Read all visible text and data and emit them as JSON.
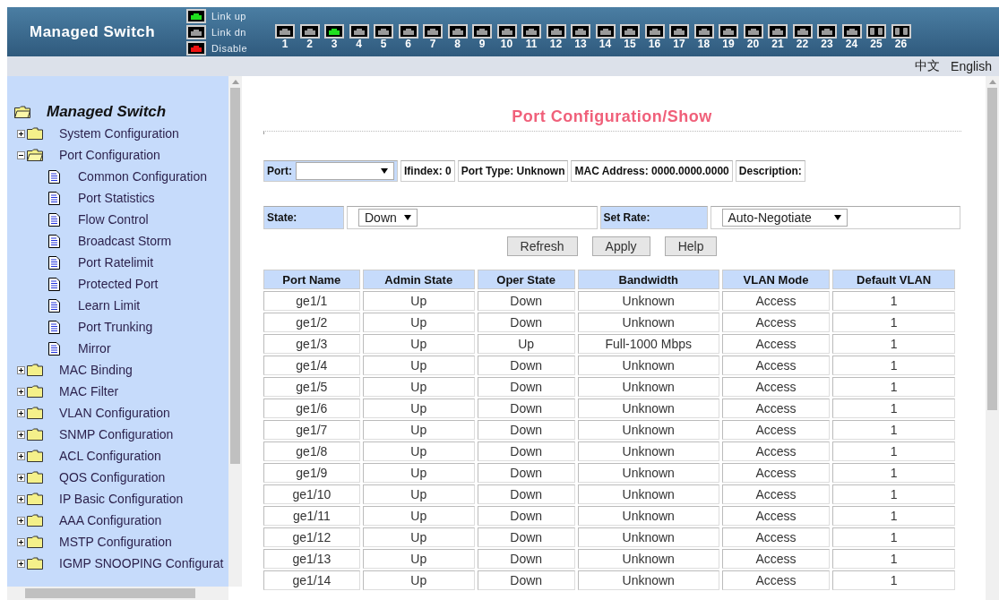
{
  "header": {
    "title": "Managed Switch",
    "legend": [
      {
        "label": "Link up",
        "color": "#1fe01f"
      },
      {
        "label": "Link dn",
        "color": "#9a9a9a"
      },
      {
        "label": "Disable",
        "color": "#ee1111"
      }
    ],
    "ports": [
      {
        "label": "1",
        "kind": "copper",
        "color": "#9a9a9a"
      },
      {
        "label": "2",
        "kind": "copper",
        "color": "#9a9a9a"
      },
      {
        "label": "3",
        "kind": "copper",
        "color": "#1fe01f"
      },
      {
        "label": "4",
        "kind": "copper",
        "color": "#9a9a9a"
      },
      {
        "label": "5",
        "kind": "copper",
        "color": "#9a9a9a"
      },
      {
        "label": "6",
        "kind": "copper",
        "color": "#9a9a9a"
      },
      {
        "label": "7",
        "kind": "copper",
        "color": "#9a9a9a"
      },
      {
        "label": "8",
        "kind": "copper",
        "color": "#9a9a9a"
      },
      {
        "label": "9",
        "kind": "copper",
        "color": "#9a9a9a"
      },
      {
        "label": "10",
        "kind": "copper",
        "color": "#9a9a9a"
      },
      {
        "label": "11",
        "kind": "copper",
        "color": "#9a9a9a"
      },
      {
        "label": "12",
        "kind": "copper",
        "color": "#9a9a9a"
      },
      {
        "label": "13",
        "kind": "copper",
        "color": "#9a9a9a"
      },
      {
        "label": "14",
        "kind": "copper",
        "color": "#9a9a9a"
      },
      {
        "label": "15",
        "kind": "copper",
        "color": "#9a9a9a"
      },
      {
        "label": "16",
        "kind": "copper",
        "color": "#9a9a9a"
      },
      {
        "label": "17",
        "kind": "copper",
        "color": "#9a9a9a"
      },
      {
        "label": "18",
        "kind": "copper",
        "color": "#9a9a9a"
      },
      {
        "label": "19",
        "kind": "copper",
        "color": "#9a9a9a"
      },
      {
        "label": "20",
        "kind": "copper",
        "color": "#9a9a9a"
      },
      {
        "label": "21",
        "kind": "copper",
        "color": "#9a9a9a"
      },
      {
        "label": "22",
        "kind": "copper",
        "color": "#9a9a9a"
      },
      {
        "label": "23",
        "kind": "copper",
        "color": "#9a9a9a"
      },
      {
        "label": "24",
        "kind": "copper",
        "color": "#9a9a9a"
      },
      {
        "label": "25",
        "kind": "fiber",
        "color": "#9a9a9a"
      },
      {
        "label": "26",
        "kind": "fiber",
        "color": "#9a9a9a"
      }
    ]
  },
  "languages": [
    "中文",
    "English"
  ],
  "sidebar": {
    "root": "Managed Switch",
    "items": [
      {
        "label": "System Configuration",
        "expanded": false
      },
      {
        "label": "Port Configuration",
        "expanded": true,
        "children": [
          {
            "label": "Common Configuration"
          },
          {
            "label": "Port Statistics"
          },
          {
            "label": "Flow Control"
          },
          {
            "label": "Broadcast Storm"
          },
          {
            "label": "Port Ratelimit"
          },
          {
            "label": "Protected Port"
          },
          {
            "label": "Learn Limit"
          },
          {
            "label": "Port Trunking"
          },
          {
            "label": "Mirror"
          }
        ]
      },
      {
        "label": "MAC Binding",
        "expanded": false
      },
      {
        "label": "MAC Filter",
        "expanded": false
      },
      {
        "label": "VLAN Configuration",
        "expanded": false
      },
      {
        "label": "SNMP Configuration",
        "expanded": false
      },
      {
        "label": "ACL Configuration",
        "expanded": false
      },
      {
        "label": "QOS Configuration",
        "expanded": false
      },
      {
        "label": "IP Basic Configuration",
        "expanded": false
      },
      {
        "label": "AAA Configuration",
        "expanded": false
      },
      {
        "label": "MSTP Configuration",
        "expanded": false
      },
      {
        "label": "IGMP SNOOPING Configurat",
        "expanded": false
      }
    ]
  },
  "content": {
    "title": "Port Configuration/Show",
    "info": {
      "port_label": "Port:",
      "ifindex": "Ifindex: 0",
      "port_type": "Port Type: Unknown",
      "mac": "MAC Address: 0000.0000.0000",
      "description": "Description:"
    },
    "state_label": "State:",
    "state_value": "Down",
    "rate_label": "Set Rate:",
    "rate_value": "Auto-Negotiate",
    "buttons": [
      "Refresh",
      "Apply",
      "Help"
    ],
    "table": {
      "columns": [
        "Port Name",
        "Admin State",
        "Oper State",
        "Bandwidth",
        "VLAN Mode",
        "Default VLAN"
      ],
      "rows": [
        [
          "ge1/1",
          "Up",
          "Down",
          "Unknown",
          "Access",
          "1"
        ],
        [
          "ge1/2",
          "Up",
          "Down",
          "Unknown",
          "Access",
          "1"
        ],
        [
          "ge1/3",
          "Up",
          "Up",
          "Full-1000 Mbps",
          "Access",
          "1"
        ],
        [
          "ge1/4",
          "Up",
          "Down",
          "Unknown",
          "Access",
          "1"
        ],
        [
          "ge1/5",
          "Up",
          "Down",
          "Unknown",
          "Access",
          "1"
        ],
        [
          "ge1/6",
          "Up",
          "Down",
          "Unknown",
          "Access",
          "1"
        ],
        [
          "ge1/7",
          "Up",
          "Down",
          "Unknown",
          "Access",
          "1"
        ],
        [
          "ge1/8",
          "Up",
          "Down",
          "Unknown",
          "Access",
          "1"
        ],
        [
          "ge1/9",
          "Up",
          "Down",
          "Unknown",
          "Access",
          "1"
        ],
        [
          "ge1/10",
          "Up",
          "Down",
          "Unknown",
          "Access",
          "1"
        ],
        [
          "ge1/11",
          "Up",
          "Down",
          "Unknown",
          "Access",
          "1"
        ],
        [
          "ge1/12",
          "Up",
          "Down",
          "Unknown",
          "Access",
          "1"
        ],
        [
          "ge1/13",
          "Up",
          "Down",
          "Unknown",
          "Access",
          "1"
        ],
        [
          "ge1/14",
          "Up",
          "Down",
          "Unknown",
          "Access",
          "1"
        ]
      ]
    }
  }
}
